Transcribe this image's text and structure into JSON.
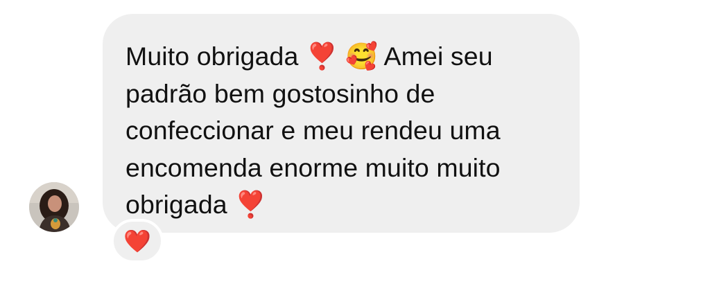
{
  "conversation": {
    "incoming_message": {
      "text": "Muito obrigada ❣️ 🥰 Amei seu\npadrão bem gostosinho de\nconfeccionar e meu rendeu uma\nencomenda enorme muito muito\nobrigada ❣️"
    },
    "reaction": {
      "emoji": "❤️",
      "icon": "heart-reaction-icon"
    },
    "sender_avatar": {
      "icon": "profile-photo"
    }
  },
  "colors": {
    "bubble_background": "#efefef",
    "text": "#111111",
    "heart": "#e0202a",
    "page_background": "#ffffff"
  }
}
